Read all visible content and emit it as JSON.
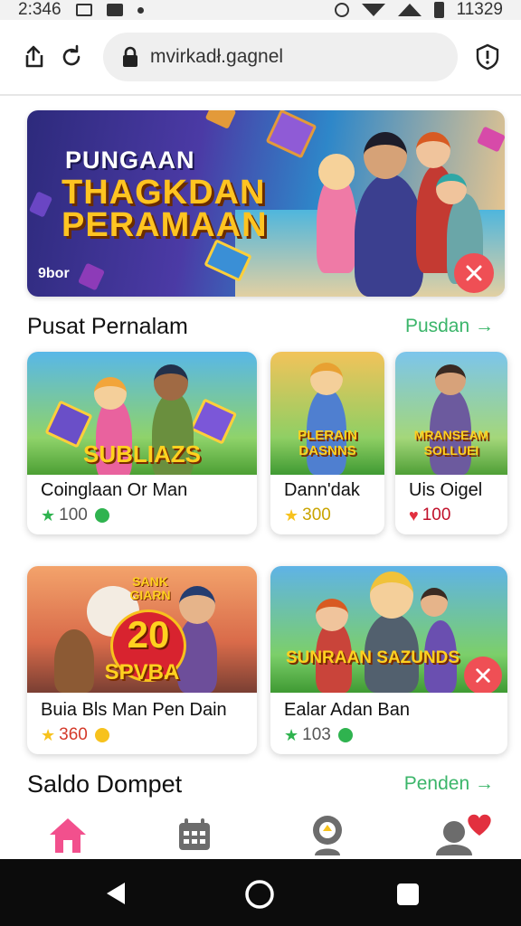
{
  "status_bar": {
    "time": "2:346",
    "right_text": "11329"
  },
  "browser": {
    "url": "mvirkadł.gagnel"
  },
  "hero": {
    "line1": "PUNGAAN",
    "line2": "THAGKDAN",
    "line3": "PERAMAAN",
    "tag": "9bor"
  },
  "popular": {
    "title": "Pusat Pernalam",
    "link": "Pusdan →",
    "cards": [
      {
        "art_text": "SUBLIAZS",
        "name": "Coinglaan Or Man",
        "rating_icon": "star",
        "value": "100",
        "icon_color": "#2fb34f"
      },
      {
        "art_text": "PLERAIN DASNNS",
        "name": "Dann'dak",
        "rating_icon": "star",
        "value": "300",
        "icon_color": "#f7c21d"
      },
      {
        "art_text": "MRANSEAM SOLLUEI",
        "name": "Uis Oigel",
        "rating_icon": "heart",
        "value": "100",
        "icon_color": "#e2303f"
      }
    ]
  },
  "featured": {
    "cards": [
      {
        "art_badge": "SANK GIARN",
        "art_number": "20",
        "art_text": "SPVBA",
        "name": "Buia Bls Man Pen Dain",
        "rating_icon": "star",
        "value": "360",
        "icon_color": "#f7c21d"
      },
      {
        "art_text": "SUNRAAN SAZUNDS",
        "name": "Ealar Adan Ban",
        "rating_icon": "star",
        "value": "103",
        "icon_color": "#2fb34f"
      }
    ]
  },
  "wallet": {
    "title": "Saldo Dompet",
    "link": "Penden →"
  },
  "bottom_tabs": [
    {
      "icon": "home-icon"
    },
    {
      "icon": "calendar-icon"
    },
    {
      "icon": "search-game-icon"
    },
    {
      "icon": "profile-heart-icon"
    }
  ],
  "colors": {
    "accent_green": "#3bb56a",
    "close_red": "#ef4f55",
    "home_pink": "#f2508d"
  }
}
